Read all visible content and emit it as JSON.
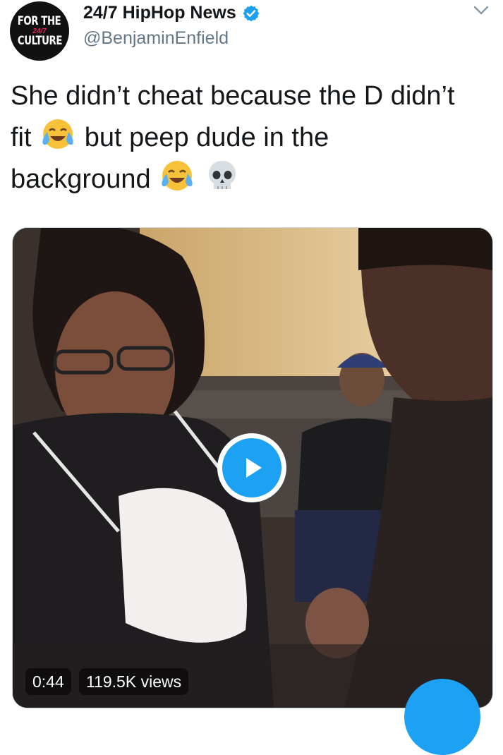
{
  "header": {
    "avatar_lines": [
      "FOR THE",
      "24/7",
      "CULTURE"
    ],
    "display_name": "24/7 HipHop News",
    "handle": "@BenjaminEnfield",
    "verified_icon": "verified-badge-icon",
    "menu_icon": "chevron-down-icon"
  },
  "tweet": {
    "line1": "She didn’t cheat because the D didn’t",
    "line2a": "fit",
    "line2b": "but peep dude in the",
    "line3": "background",
    "emoji_1": "face-with-tears-of-joy-icon",
    "emoji_2": "skull-icon"
  },
  "media": {
    "duration": "0:44",
    "views": "119.5K views",
    "play_icon": "play-icon"
  },
  "colors": {
    "accent": "#1da1f2",
    "handle_gray": "#657786",
    "text": "#14171a"
  }
}
